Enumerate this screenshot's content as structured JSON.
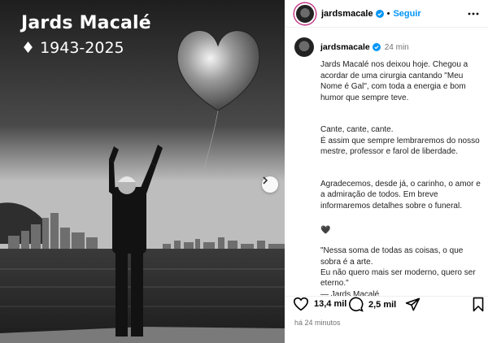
{
  "photo": {
    "title": "Jards Macalé",
    "dates": "♦ 1943-2025",
    "next_label": "›"
  },
  "header": {
    "username": "jardsmacale",
    "dot": "•",
    "follow_label": "Seguir",
    "more_label": "⋯"
  },
  "post": {
    "username": "jardsmacale",
    "time": "24 min",
    "paragraphs": [
      "Jards Macalé nos deixou hoje. Chegou a acordar de uma cirurgia cantando \"Meu Nome é Gal\", com toda a energia e bom humor que sempre teve.",
      "Cante, cante, cante.\nÉ assim que sempre lembraremos do nosso mestre, professor e farol de liberdade.",
      "Agradecemos, desde já, o carinho, o amor e a admiração de todos. Em breve informaremos detalhes sobre o funeral.",
      "\"Nessa soma de todas as coisas, o que sobra é a arte.\nEu não quero mais ser moderno, quero ser eterno.\"\n— Jards Macalé"
    ],
    "heart_emoji": "🖤"
  },
  "actions": {
    "likes": "13,4 mil",
    "comments": "2,5 mil",
    "posted_ago": "há 24 minutos"
  },
  "colors": {
    "accent": "#0095f6",
    "verified": "#0095f6",
    "muted": "#737373"
  }
}
